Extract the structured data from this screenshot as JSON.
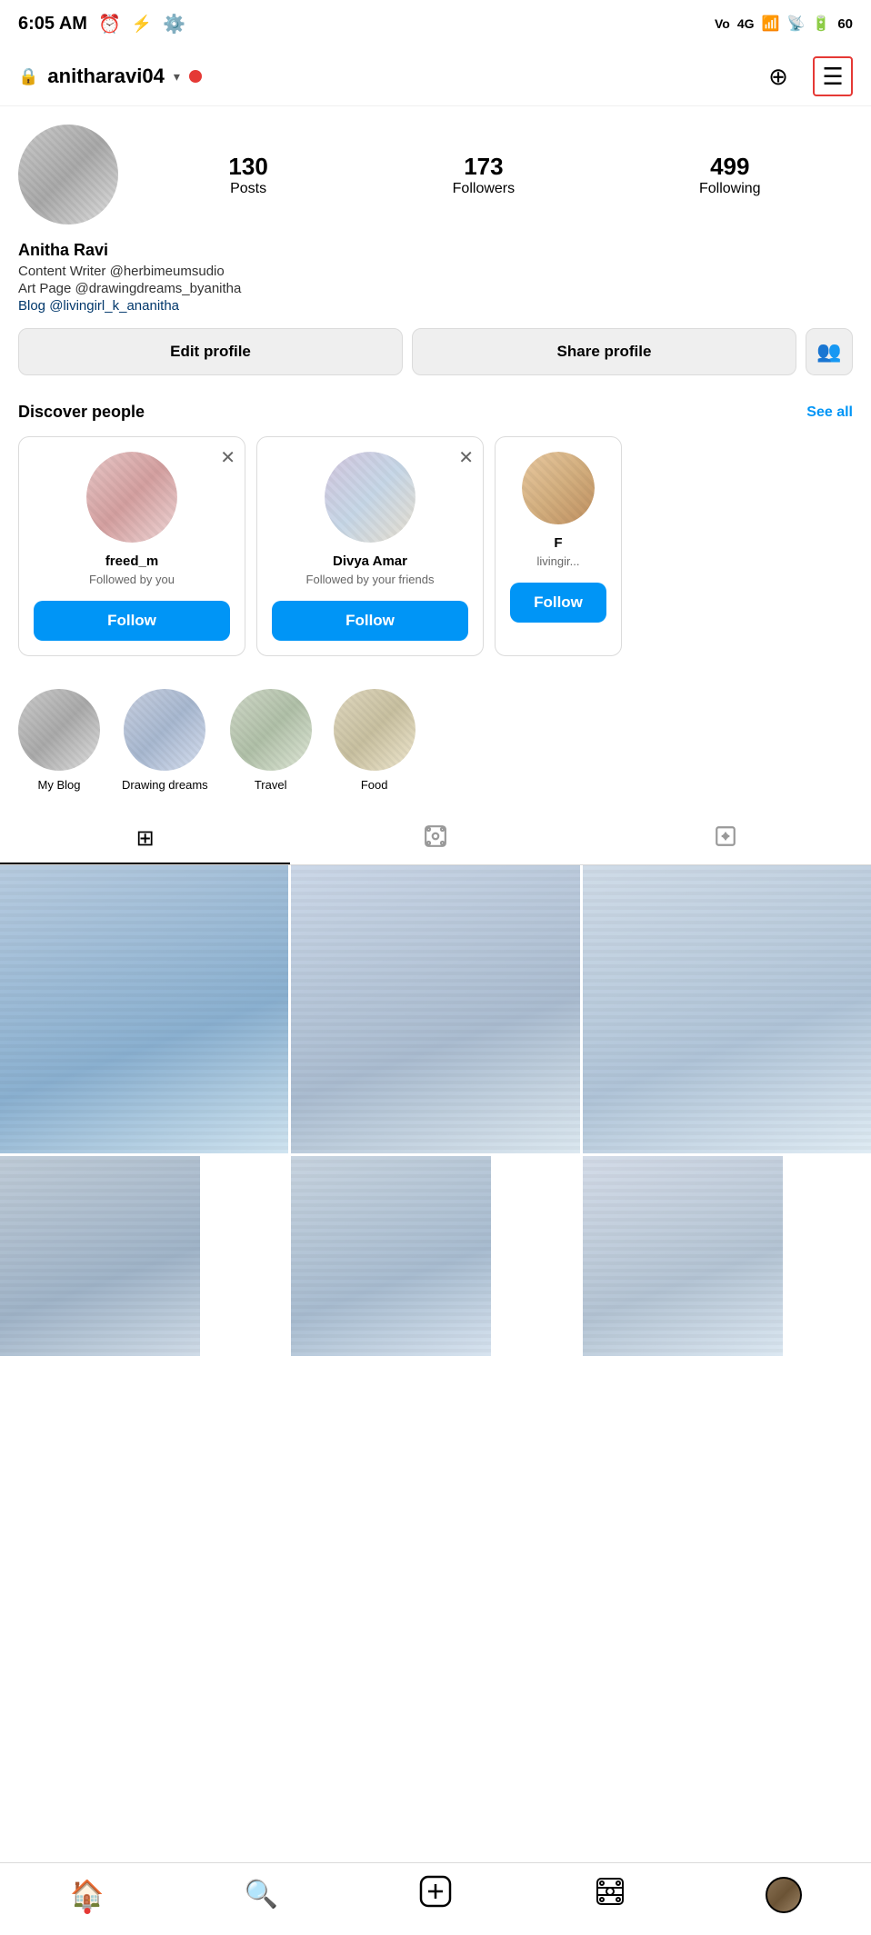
{
  "statusBar": {
    "time": "6:05 AM",
    "batteryLevel": "60"
  },
  "topNav": {
    "username": "anitharavi04",
    "addIconLabel": "➕",
    "menuIconLabel": "☰"
  },
  "profile": {
    "stats": {
      "postsCount": "130",
      "postsLabel": "Posts",
      "followersCount": "173",
      "followersLabel": "Followers",
      "followingCount": "499",
      "followingLabel": "Following"
    },
    "bio": {
      "name": "Anitha Ravi",
      "line1": "Content Writer @herbimeumsudio",
      "line2": "Art Page @drawingdreams_byanitha",
      "line3": "Blog @livingirl_k_ananitha"
    },
    "buttons": {
      "editProfile": "Edit profile",
      "shareProfile": "Share profile"
    }
  },
  "discoverPeople": {
    "title": "Discover people",
    "seeAll": "See all",
    "cards": [
      {
        "name": "freed_m",
        "sub": "Followed by you",
        "followLabel": "Follow"
      },
      {
        "name": "Divya Amar",
        "sub": "Followed by your friends",
        "followLabel": "Follow"
      },
      {
        "name": "F",
        "sub": "livingir...",
        "followLabel": "Follow"
      }
    ]
  },
  "highlights": [
    {
      "label": "My Blog"
    },
    {
      "label": "Drawing dreams"
    },
    {
      "label": "Travel"
    },
    {
      "label": "Food"
    }
  ],
  "tabs": {
    "grid": "⊞",
    "reels": "▶",
    "tagged": "👤"
  },
  "bottomNav": {
    "home": "🏠",
    "search": "🔍",
    "add": "➕",
    "reels": "🎬",
    "profile": "avatar"
  }
}
